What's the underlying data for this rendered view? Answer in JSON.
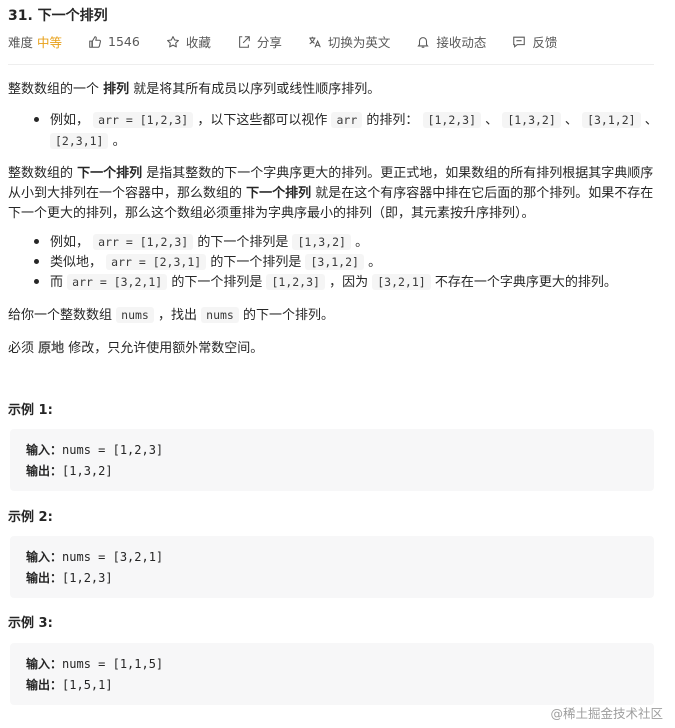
{
  "header": {
    "title": "31. 下一个排列",
    "difficulty_label": "难度",
    "difficulty_value": "中等",
    "likes": "1546",
    "favorite": "收藏",
    "share": "分享",
    "switch_en": "切换为英文",
    "subscribe": "接收动态",
    "feedback": "反馈"
  },
  "description": {
    "p1_pre": "整数数组的一个 ",
    "p1_bold": "排列",
    "p1_post": "  就是将其所有成员以序列或线性顺序排列。",
    "b1_pre": "例如，",
    "b1_code1": "arr = [1,2,3]",
    "b1_mid": "，以下这些都可以视作",
    "b1_code2": "arr",
    "b1_mid2": "的排列：",
    "b1_code3": "[1,2,3]",
    "b1_sep1": "、",
    "b1_code4": "[1,3,2]",
    "b1_sep2": "、",
    "b1_code5": "[3,1,2]",
    "b1_sep3": "、",
    "b1_code6": "[2,3,1]",
    "b1_end": "。",
    "p2_l1_pre": "整数数组的 ",
    "p2_l1_bold": "下一个排列",
    "p2_l1_post": " 是指其整数的下一个字典序更大的排列。更正式地，如果数组的所有排列根据其字典顺序",
    "p2_l2_pre": "从小到大排列在一个容器中，那么数组的 ",
    "p2_l2_bold": "下一个排列",
    "p2_l2_post": " 就是在这个有序容器中排在它后面的那个排列。如果不存在",
    "p2_l3": "下一个更大的排列，那么这个数组必须重排为字典序最小的排列（即，其元素按升序排列）。",
    "e1_pre": "例如，",
    "e1_code1": "arr = [1,2,3]",
    "e1_mid": "的下一个排列是",
    "e1_code2": "[1,3,2]",
    "e1_end": "。",
    "e2_pre": "类似地，",
    "e2_code1": "arr = [2,3,1]",
    "e2_mid": "的下一个排列是",
    "e2_code2": "[3,1,2]",
    "e2_end": "。",
    "e3_pre": "而",
    "e3_code1": "arr = [3,2,1]",
    "e3_mid": "的下一个排列是",
    "e3_code2": "[1,2,3]",
    "e3_mid2": "，因为",
    "e3_code3": "[3,2,1]",
    "e3_end": "不存在一个字典序更大的排列。",
    "p3_pre": "给你一个整数数组",
    "p3_code1": "nums",
    "p3_mid": "，找出",
    "p3_code2": "nums",
    "p3_end": "的下一个排列。",
    "p4_pre": "必须 ",
    "p4_bold": "原地",
    "p4_end": " 修改，只允许使用额外常数空间。"
  },
  "examples": [
    {
      "title": "示例 1:",
      "input_label": "输入：",
      "input": "nums = [1,2,3]",
      "output_label": "输出：",
      "output": "[1,3,2]"
    },
    {
      "title": "示例 2:",
      "input_label": "输入：",
      "input": "nums = [3,2,1]",
      "output_label": "输出：",
      "output": "[1,2,3]"
    },
    {
      "title": "示例 3:",
      "input_label": "输入：",
      "input": "nums = [1,1,5]",
      "output_label": "输出：",
      "output": "[1,5,1]"
    }
  ],
  "watermark": "@稀土掘金技术社区",
  "icons": [
    "thumbs-up-icon",
    "star-icon",
    "share-icon",
    "translate-icon",
    "bell-icon",
    "feedback-icon"
  ]
}
